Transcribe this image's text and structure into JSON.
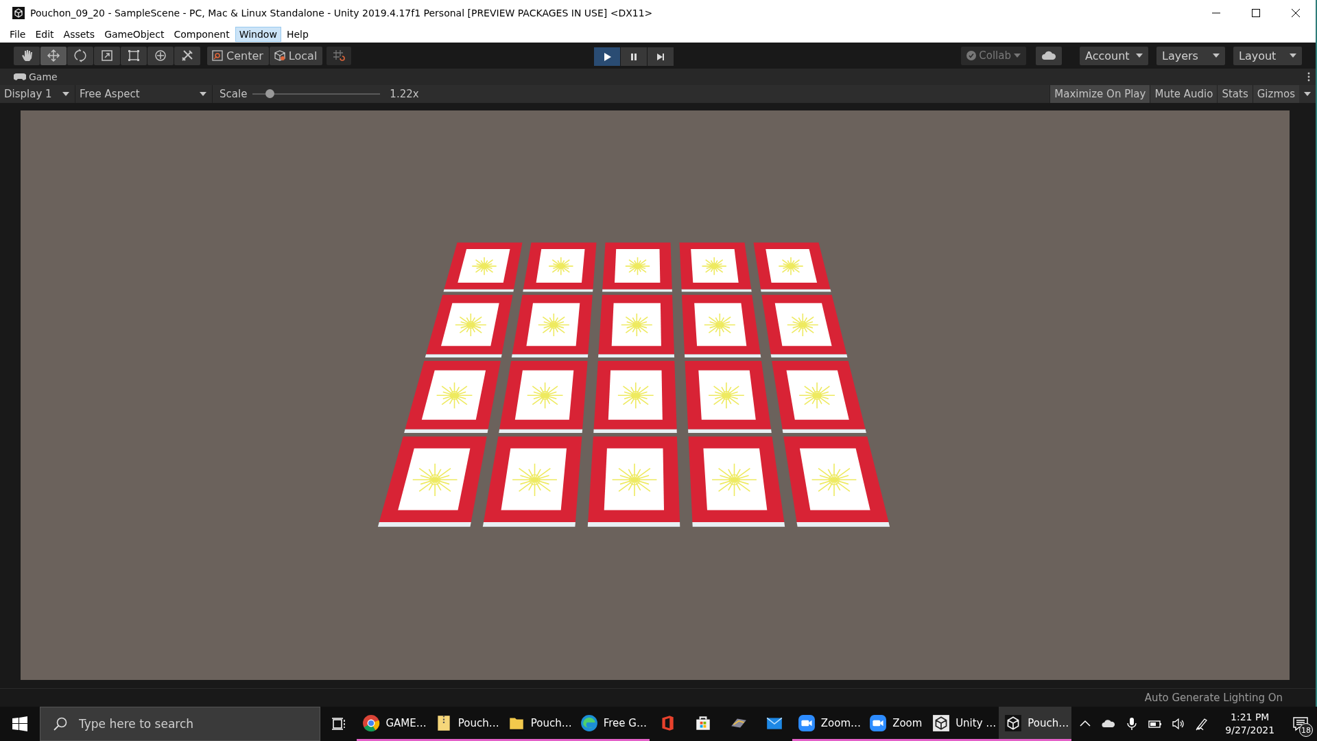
{
  "window": {
    "title": "Pouchon_09_20 - SampleScene - PC, Mac & Linux Standalone - Unity 2019.4.17f1 Personal [PREVIEW PACKAGES IN USE] <DX11>"
  },
  "menu": [
    {
      "label": "File",
      "selected": false
    },
    {
      "label": "Edit",
      "selected": false
    },
    {
      "label": "Assets",
      "selected": false
    },
    {
      "label": "GameObject",
      "selected": false
    },
    {
      "label": "Component",
      "selected": false
    },
    {
      "label": "Window",
      "selected": true
    },
    {
      "label": "Help",
      "selected": false
    }
  ],
  "tools": [
    {
      "kind": "hand",
      "selected": false
    },
    {
      "kind": "move",
      "selected": true
    },
    {
      "kind": "rotate",
      "selected": false
    },
    {
      "kind": "scale",
      "selected": false
    },
    {
      "kind": "rect",
      "selected": false
    },
    {
      "kind": "transform",
      "selected": false
    },
    {
      "kind": "custom",
      "selected": false
    }
  ],
  "pivot_buttons": [
    {
      "kind": "center",
      "label": "Center"
    },
    {
      "kind": "local",
      "label": "Local"
    }
  ],
  "play_controls": [
    {
      "kind": "play",
      "selected": true
    },
    {
      "kind": "pause",
      "selected": false
    },
    {
      "kind": "step",
      "selected": false
    }
  ],
  "collab": {
    "label": "Collab",
    "disabled": true
  },
  "dropdowns": [
    "Account",
    "Layers",
    "Layout"
  ],
  "game_tab": {
    "label": "Game"
  },
  "game_toolbar": {
    "display": "Display 1",
    "aspect": "Free Aspect",
    "scale_label": "Scale",
    "scale": {
      "level": 0.13
    },
    "scale_reading": "1.22x",
    "toggles": [
      {
        "label": "Maximize On Play",
        "on": true
      },
      {
        "label": "Mute Audio",
        "on": false
      },
      {
        "label": "Stats",
        "on": false
      },
      {
        "label": "Gizmos",
        "on": false
      }
    ]
  },
  "status_bar": {
    "text": "Auto Generate Lighting On"
  },
  "taskbar": {
    "search": {
      "placeholder": "Type here to search"
    },
    "apps": [
      {
        "kind": "chrome",
        "label": "GAME…",
        "running": true,
        "selected": false
      },
      {
        "kind": "zip",
        "label": "Pouch…",
        "running": true,
        "selected": false
      },
      {
        "kind": "folder",
        "label": "Pouch…",
        "running": true,
        "selected": false
      },
      {
        "kind": "edge",
        "label": "Free G…",
        "running": true,
        "selected": false
      },
      {
        "kind": "office",
        "running": false,
        "selected": false
      },
      {
        "kind": "store",
        "running": false,
        "selected": false
      },
      {
        "kind": "aws",
        "running": false,
        "selected": false
      },
      {
        "kind": "mail",
        "running": false,
        "selected": false
      },
      {
        "kind": "zoom",
        "label": "Zoom…",
        "running": true,
        "selected": false
      },
      {
        "kind": "zoom",
        "label": "Zoom",
        "running": true,
        "selected": false
      },
      {
        "kind": "unity-light",
        "label": "Unity …",
        "running": true,
        "selected": false
      },
      {
        "kind": "unity-dark",
        "label": "Pouch…",
        "running": true,
        "selected": true
      }
    ],
    "time": "1:21 PM",
    "date": "9/27/2021",
    "notifications": "18"
  }
}
